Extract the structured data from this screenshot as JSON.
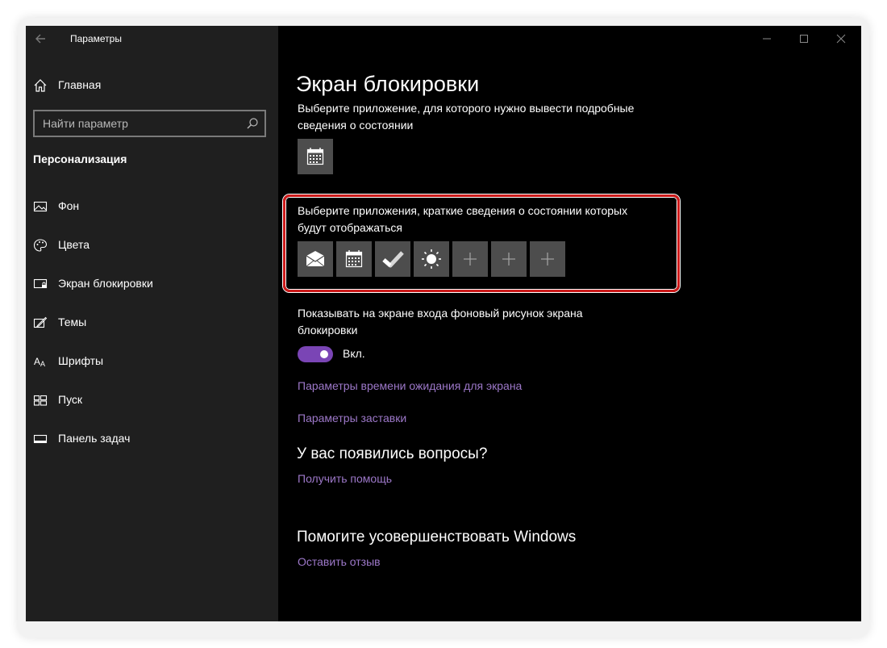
{
  "window": {
    "title": "Параметры"
  },
  "sidebar": {
    "home_label": "Главная",
    "search": {
      "placeholder": "Найти параметр",
      "value": ""
    },
    "section_title": "Персонализация",
    "items": [
      {
        "label": "Фон",
        "icon": "picture-icon"
      },
      {
        "label": "Цвета",
        "icon": "palette-icon"
      },
      {
        "label": "Экран блокировки",
        "icon": "lock-screen-icon"
      },
      {
        "label": "Темы",
        "icon": "themes-icon"
      },
      {
        "label": "Шрифты",
        "icon": "fonts-icon"
      },
      {
        "label": "Пуск",
        "icon": "start-icon"
      },
      {
        "label": "Панель задач",
        "icon": "taskbar-icon"
      }
    ]
  },
  "main": {
    "page_title": "Экран блокировки",
    "detailed_status_desc": "Выберите приложение, для которого нужно вывести подробные сведения о состоянии",
    "detailed_status_app": "calendar-icon",
    "quick_status_desc": "Выберите приложения, краткие сведения о состоянии которых будут отображаться",
    "quick_status_apps": [
      "mail-icon",
      "calendar-icon",
      "checkmark-icon",
      "weather-sun-icon",
      "plus-icon",
      "plus-icon",
      "plus-icon"
    ],
    "signin_bg_desc": "Показывать на экране входа фоновый рисунок экрана блокировки",
    "signin_bg_toggle": {
      "state": "on",
      "label": "Вкл."
    },
    "timeout_link": "Параметры времени ожидания для экрана",
    "screensaver_link": "Параметры заставки",
    "questions_heading": "У вас появились вопросы?",
    "help_link": "Получить помощь",
    "improve_heading": "Помогите усовершенствовать Windows",
    "feedback_link": "Оставить отзыв"
  },
  "colors": {
    "sidebar_bg": "#1f1f1f",
    "main_bg": "#000000",
    "accent": "#7a45b5",
    "link": "#9d78c9",
    "tile_bg": "#4d4d4d",
    "highlight": "#cc1a1a"
  }
}
